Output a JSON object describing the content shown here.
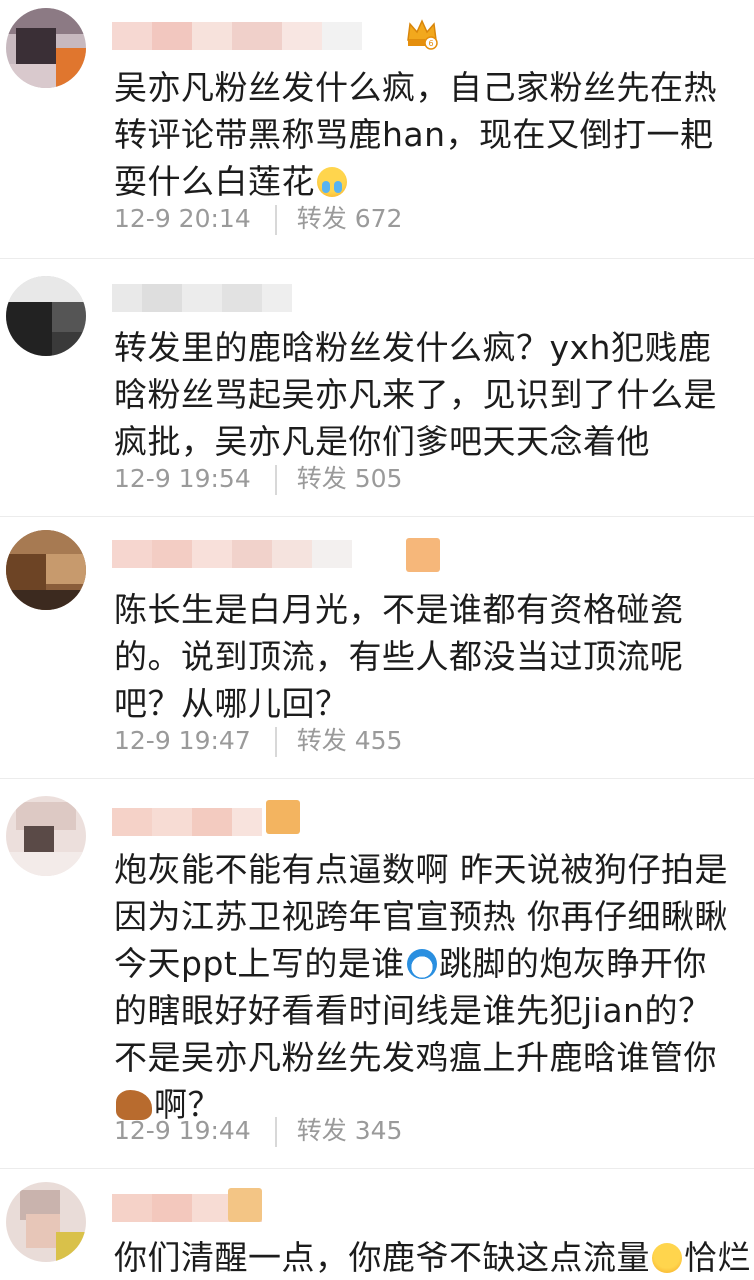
{
  "comments": [
    {
      "text": "吴亦凡粉丝发什么疯，自己家粉丝先在热转评论带黑称骂鹿han，现在又倒打一耙耍什么白莲花",
      "emoji": "crying-face",
      "time": "12-9 20:14",
      "repost_label": "转发",
      "repost_count": "672",
      "has_badge": "crown-badge"
    },
    {
      "text": "转发里的鹿晗粉丝发什么疯？yxh犯贱鹿晗粉丝骂起吴亦凡来了，见识到了什么是疯批，吴亦凡是你们爹吧天天念着他",
      "time": "12-9 19:54",
      "repost_label": "转发",
      "repost_count": "505"
    },
    {
      "text": "陈长生是白月光，不是谁都有资格碰瓷的。说到顶流，有些人都没当过顶流呢吧？从哪儿回？",
      "time": "12-9 19:47",
      "repost_label": "转发",
      "repost_count": "455"
    },
    {
      "text_part1": "炮灰能不能有点逼数啊 昨天说被狗仔拍是因为江苏卫视跨年官宣预热 你再仔细瞅瞅今天ppt上写的是谁",
      "text_part2": "跳脚的炮灰睁开你的瞎眼好好看看时间线是谁先犯jian的？不是吴亦凡粉丝先发鸡瘟上升鹿晗谁管你",
      "text_part3": "啊？",
      "emoji1": "doraemon",
      "emoji2": "horse",
      "time": "12-9 19:44",
      "repost_label": "转发",
      "repost_count": "345"
    },
    {
      "text": "你们清醒一点，你鹿爷不缺这点流量",
      "text_tail": "恰烂",
      "emoji": "drooling-face"
    }
  ],
  "colors": {
    "meta_gray": "#9a9a9a",
    "divider": "#ececec",
    "text": "#1c1c1c"
  }
}
